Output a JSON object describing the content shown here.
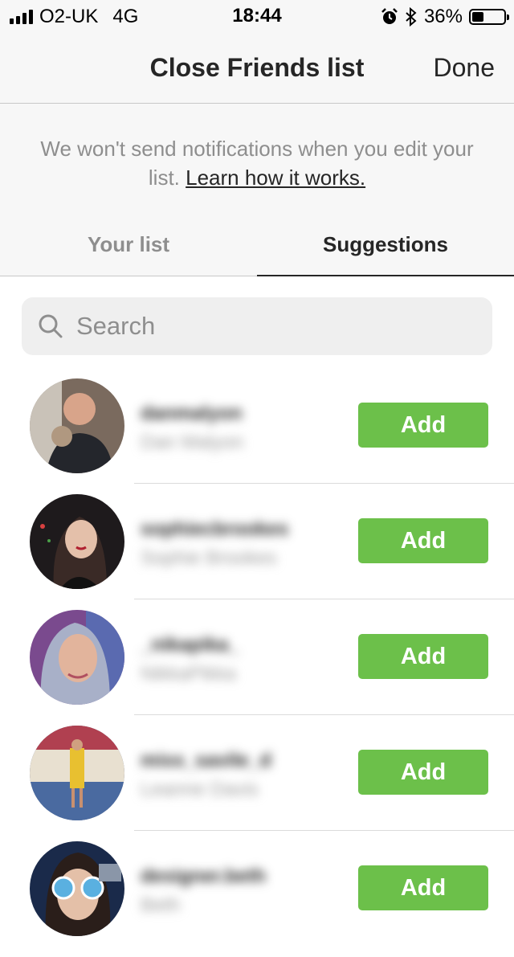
{
  "status_bar": {
    "carrier": "O2-UK",
    "network": "4G",
    "time": "18:44",
    "battery_percent_label": "36%",
    "battery_level": 0.36,
    "icons": [
      "signal-bars-icon",
      "alarm-icon",
      "bluetooth-icon",
      "battery-icon"
    ]
  },
  "nav": {
    "title": "Close Friends list",
    "done_label": "Done"
  },
  "info": {
    "message": "We won't send notifications when you edit your list.",
    "link": "Learn how it works."
  },
  "tabs": [
    {
      "label": "Your list",
      "active": false
    },
    {
      "label": "Suggestions",
      "active": true
    }
  ],
  "search": {
    "placeholder": "Search",
    "value": ""
  },
  "add_label": "Add",
  "suggestions": [
    {
      "username": "danmalyon",
      "full_name": "Dan Malyon"
    },
    {
      "username": "sophiecbrookes",
      "full_name": "Sophie Brookes"
    },
    {
      "username": "_nikapika_",
      "full_name": "NikkaPikka"
    },
    {
      "username": "miss_savile_d",
      "full_name": "Leanne Davis"
    },
    {
      "username": "designer.beth",
      "full_name": "Beth"
    }
  ],
  "colors": {
    "add_button": "#6cc04a",
    "nav_background": "#f7f7f7",
    "muted_text": "#8e8e8e",
    "primary_text": "#262626"
  }
}
